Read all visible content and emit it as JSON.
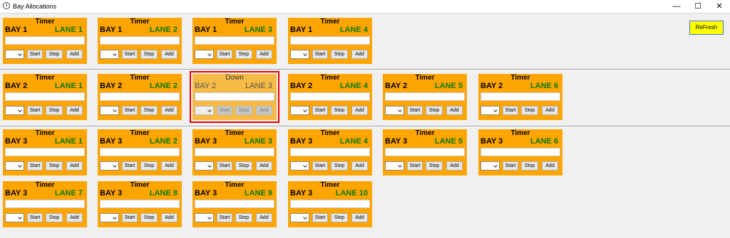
{
  "window": {
    "title": "Bay Allocations",
    "min_glyph": "—",
    "max_glyph": "☐",
    "close_glyph": "✕"
  },
  "refresh_label": "ReFresh",
  "buttons": {
    "start": "Start",
    "stop": "Stop",
    "add": "Add"
  },
  "cards": [
    {
      "state": "Timer",
      "bay": "BAY 1",
      "lane": "LANE 1"
    },
    {
      "state": "Timer",
      "bay": "BAY 1",
      "lane": "LANE 2"
    },
    {
      "state": "Timer",
      "bay": "BAY 1",
      "lane": "LANE 3"
    },
    {
      "state": "Timer",
      "bay": "BAY 1",
      "lane": "LANE 4"
    },
    {
      "state": "Timer",
      "bay": "BAY 2",
      "lane": "LANE 1"
    },
    {
      "state": "Timer",
      "bay": "BAY 2",
      "lane": "LANE 2"
    },
    {
      "state": "Down",
      "bay": "BAY 2",
      "lane": "LANE 3"
    },
    {
      "state": "Timer",
      "bay": "BAY 2",
      "lane": "LANE 4"
    },
    {
      "state": "Timer",
      "bay": "BAY 2",
      "lane": "LANE 5"
    },
    {
      "state": "Timer",
      "bay": "BAY 2",
      "lane": "LANE 6"
    },
    {
      "state": "Timer",
      "bay": "BAY 3",
      "lane": "LANE 1"
    },
    {
      "state": "Timer",
      "bay": "BAY 3",
      "lane": "LANE 2"
    },
    {
      "state": "Timer",
      "bay": "BAY 3",
      "lane": "LANE 3"
    },
    {
      "state": "Timer",
      "bay": "BAY 3",
      "lane": "LANE 4"
    },
    {
      "state": "Timer",
      "bay": "BAY 3",
      "lane": "LANE 5"
    },
    {
      "state": "Timer",
      "bay": "BAY 3",
      "lane": "LANE 6"
    },
    {
      "state": "Timer",
      "bay": "BAY 3",
      "lane": "LANE 7"
    },
    {
      "state": "Timer",
      "bay": "BAY 3",
      "lane": "LANE 8"
    },
    {
      "state": "Timer",
      "bay": "BAY 3",
      "lane": "LANE 9"
    },
    {
      "state": "Timer",
      "bay": "BAY 3",
      "lane": "LANE 10"
    }
  ]
}
